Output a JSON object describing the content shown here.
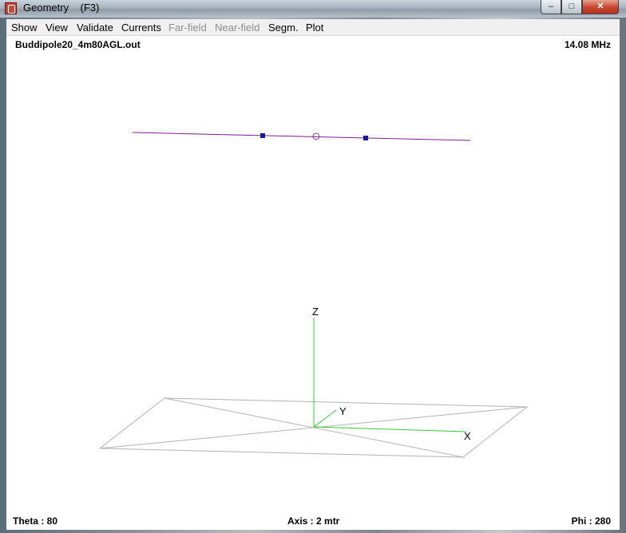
{
  "window": {
    "title": "Geometry    (F3)",
    "controls": {
      "minimize": "–",
      "maximize": "□",
      "close": "✕"
    }
  },
  "menu": {
    "items": [
      {
        "label": "Show",
        "enabled": true
      },
      {
        "label": "View",
        "enabled": true
      },
      {
        "label": "Validate",
        "enabled": true
      },
      {
        "label": "Currents",
        "enabled": true
      },
      {
        "label": "Far-field",
        "enabled": false
      },
      {
        "label": "Near-field",
        "enabled": false
      },
      {
        "label": "Segm.",
        "enabled": true
      },
      {
        "label": "Plot",
        "enabled": true
      }
    ]
  },
  "view": {
    "filename": "Buddipole20_4m80AGL.out",
    "frequency": "14.08 MHz",
    "theta": "Theta : 80",
    "axis": "Axis : 2 mtr",
    "phi": "Phi : 280",
    "axes": {
      "x": "X",
      "y": "Y",
      "z": "Z"
    }
  },
  "colors": {
    "wire": "#7a1e8e",
    "load_marker": "#1a1aa0",
    "source_marker": "#a0309a",
    "axis": "#33cc33",
    "ground": "#b4b4b4",
    "canvas_bg": "#ffffff"
  },
  "icons": {
    "app": "antenna-app-icon",
    "source": "source-circle-icon",
    "load": "load-square-icon"
  }
}
